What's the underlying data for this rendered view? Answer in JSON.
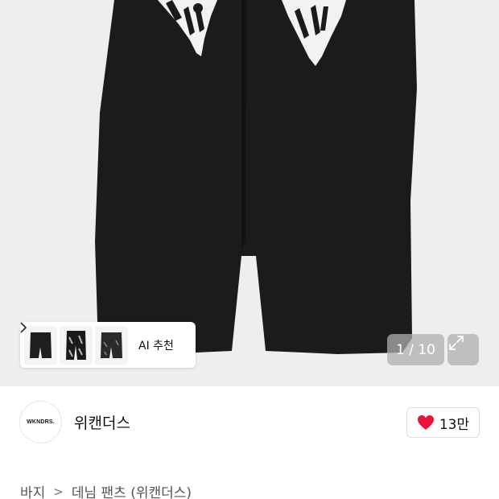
{
  "gallery": {
    "ai_recommend_label": "AI 추천",
    "chevron_icon": "chevron-right-icon",
    "counter": "1 / 10",
    "expand_icon": "expand-diagonal-icon",
    "thumbnails": [
      "pants-thumbnail-1",
      "pants-thumbnail-2",
      "pants-thumbnail-3"
    ]
  },
  "brand": {
    "logo_text": "WKNDRS.",
    "name": "위캔더스",
    "like_icon": "heart-icon",
    "like_color": "#e8133a",
    "like_count": "13만"
  },
  "breadcrumb": {
    "items": [
      "바지",
      "데님 팬츠 (위캔더스)"
    ],
    "separator": ">"
  }
}
